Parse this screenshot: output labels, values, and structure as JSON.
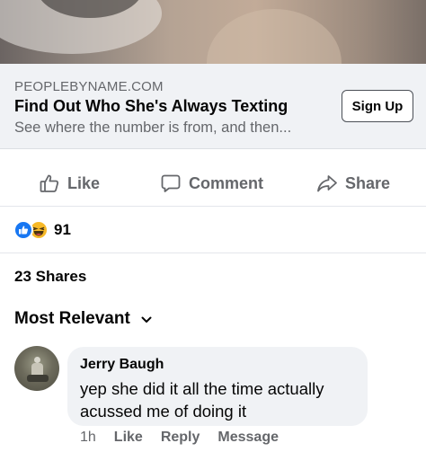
{
  "ad": {
    "domain": "PEOPLEBYNAME.COM",
    "title": "Find Out Who She's Always Texting",
    "description": "See where the number is from, and then...",
    "cta_label": "Sign Up"
  },
  "actions": {
    "like_label": "Like",
    "comment_label": "Comment",
    "share_label": "Share"
  },
  "reactions": {
    "icons": [
      "like-reaction-icon",
      "haha-reaction-icon"
    ],
    "count": "91"
  },
  "shares_text": "23 Shares",
  "comments_sort": {
    "label": "Most Relevant"
  },
  "comments": [
    {
      "author": "Jerry Baugh",
      "text": "yep she did it all the time actually acussed me of doing it",
      "time": "1h",
      "like_label": "Like",
      "reply_label": "Reply",
      "message_label": "Message"
    }
  ],
  "colors": {
    "brand_blue": "#1877f2",
    "haha_yellow": "#f7b928",
    "secondary_text": "#65676b",
    "bubble_bg": "#f0f2f5"
  }
}
